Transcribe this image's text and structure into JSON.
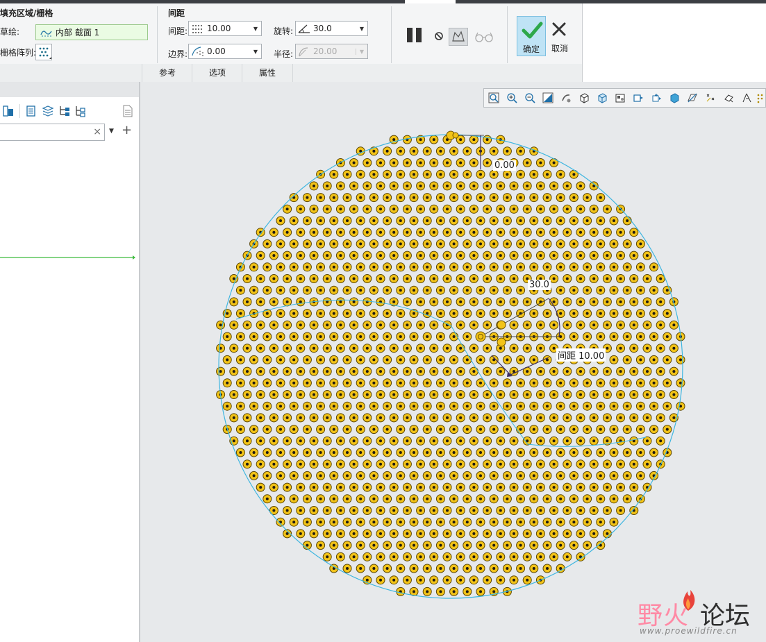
{
  "ribbon": {
    "fill_group": {
      "title": "填充区域/栅格",
      "sketch_label": "草绘:",
      "sketch_value": "内部 截面 1",
      "grid_label": "栅格阵列:"
    },
    "spacing_group": {
      "title": "间距",
      "spacing_label": "间距:",
      "spacing_value": "10.00",
      "border_label": "边界:",
      "border_value": "0.00",
      "rotation_label": "旋转:",
      "rotation_value": "30.0",
      "radius_label": "半径:",
      "radius_value": "20.00"
    },
    "tabs": [
      "参考",
      "选项",
      "属性"
    ],
    "ok_label": "确定",
    "cancel_label": "取消"
  },
  "canvas": {
    "dim_border": "0.00",
    "dim_angle": "30.0",
    "dim_spacing": "间距 10.00"
  },
  "watermark": {
    "title_a": "野火",
    "title_b": "论坛",
    "url": "www.proewildfire.cn"
  },
  "colors": {
    "point_fill": "#f2c318",
    "circle_stroke": "#3fb6e0",
    "ok_bg": "#bfe3f5",
    "ok_check": "#2ea84a"
  }
}
